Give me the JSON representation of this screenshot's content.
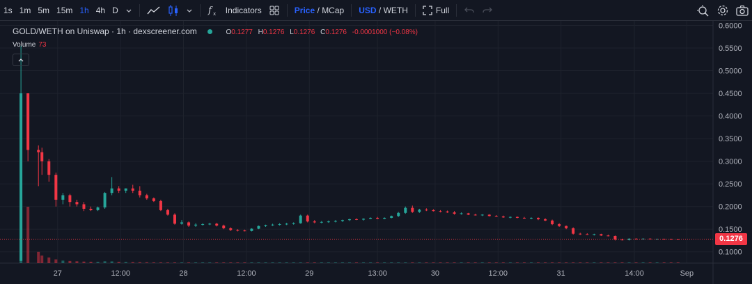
{
  "toolbar": {
    "intervals": [
      "1s",
      "1m",
      "5m",
      "15m",
      "1h",
      "4h",
      "D"
    ],
    "active_interval": "1h",
    "indicators_label": "Indicators",
    "price_label": "Price",
    "slash": "/",
    "mcap_label": "MCap",
    "usd_label": "USD",
    "weth_label": "WETH",
    "full_label": "Full",
    "icons": [
      "chevron-down-icon",
      "line-chart-icon",
      "candles-icon",
      "fx-icon",
      "grid-icon",
      "fullscreen-icon",
      "undo-icon",
      "redo-icon",
      "magic-icon",
      "gear-icon",
      "camera-icon"
    ]
  },
  "legend": {
    "title": "GOLD/WETH on Uniswap · 1h · dexscreener.com",
    "o_label": "O",
    "o_value": "0.1277",
    "h_label": "H",
    "h_value": "0.1276",
    "l_label": "L",
    "l_value": "0.1276",
    "c_label": "C",
    "c_value": "0.1276",
    "change": "-0.0001000 (−0.08%)",
    "volume_label": "Volume",
    "volume_value": "73"
  },
  "colors": {
    "up": "#26a69a",
    "down": "#f23645",
    "background": "#131722",
    "accent": "#2962ff"
  },
  "chart_data": {
    "type": "candlestick",
    "title": "GOLD/WETH on Uniswap · 1h · dexscreener.com",
    "current_price": 0.1276,
    "current_price_label": "0.1276",
    "y_ticks": [
      0.1,
      0.15,
      0.2,
      0.25,
      0.3,
      0.35,
      0.4,
      0.45,
      0.5,
      0.55,
      0.6
    ],
    "y_tick_labels": [
      "0.1000",
      "0.1500",
      "0.2000",
      "0.2500",
      "0.3000",
      "0.3500",
      "0.4000",
      "0.4500",
      "0.5000",
      "0.5500",
      "0.6000"
    ],
    "ylim": [
      0.075,
      0.61
    ],
    "x_tick_labels": [
      "27",
      "12:00",
      "28",
      "12:00",
      "29",
      "13:00",
      "30",
      "12:00",
      "31",
      "14:00",
      "Sep"
    ],
    "x_tick_hours": [
      9,
      21,
      33,
      45,
      57,
      70,
      81,
      93,
      105,
      119,
      129
    ],
    "xlim": [
      -2,
      134
    ],
    "candles": [
      {
        "t": 0,
        "o": 0.08,
        "h": 0.555,
        "l": 0.08,
        "c": 0.45
      },
      {
        "t": 1,
        "o": 0.45,
        "h": 0.45,
        "l": 0.3,
        "c": 0.325
      },
      {
        "t": 2,
        "o": 0.325,
        "h": 0.335,
        "l": 0.245,
        "c": 0.32
      },
      {
        "t": 3,
        "o": 0.32,
        "h": 0.33,
        "l": 0.27,
        "c": 0.3
      },
      {
        "t": 4,
        "o": 0.3,
        "h": 0.305,
        "l": 0.255,
        "c": 0.27
      },
      {
        "t": 5,
        "o": 0.27,
        "h": 0.275,
        "l": 0.2,
        "c": 0.215
      },
      {
        "t": 6,
        "o": 0.215,
        "h": 0.23,
        "l": 0.205,
        "c": 0.225
      },
      {
        "t": 7,
        "o": 0.225,
        "h": 0.228,
        "l": 0.2,
        "c": 0.21
      },
      {
        "t": 8,
        "o": 0.21,
        "h": 0.215,
        "l": 0.2,
        "c": 0.205
      },
      {
        "t": 9,
        "o": 0.205,
        "h": 0.21,
        "l": 0.19,
        "c": 0.195
      },
      {
        "t": 10,
        "o": 0.195,
        "h": 0.2,
        "l": 0.19,
        "c": 0.192
      },
      {
        "t": 11,
        "o": 0.192,
        "h": 0.2,
        "l": 0.19,
        "c": 0.198
      },
      {
        "t": 12,
        "o": 0.198,
        "h": 0.232,
        "l": 0.195,
        "c": 0.23
      },
      {
        "t": 13,
        "o": 0.23,
        "h": 0.265,
        "l": 0.225,
        "c": 0.24
      },
      {
        "t": 14,
        "o": 0.24,
        "h": 0.245,
        "l": 0.23,
        "c": 0.235
      },
      {
        "t": 15,
        "o": 0.235,
        "h": 0.24,
        "l": 0.23,
        "c": 0.24
      },
      {
        "t": 16,
        "o": 0.24,
        "h": 0.248,
        "l": 0.23,
        "c": 0.235
      },
      {
        "t": 17,
        "o": 0.235,
        "h": 0.245,
        "l": 0.22,
        "c": 0.225
      },
      {
        "t": 18,
        "o": 0.225,
        "h": 0.228,
        "l": 0.215,
        "c": 0.218
      },
      {
        "t": 19,
        "o": 0.218,
        "h": 0.22,
        "l": 0.21,
        "c": 0.212
      },
      {
        "t": 20,
        "o": 0.212,
        "h": 0.215,
        "l": 0.19,
        "c": 0.192
      },
      {
        "t": 21,
        "o": 0.192,
        "h": 0.195,
        "l": 0.18,
        "c": 0.182
      },
      {
        "t": 22,
        "o": 0.182,
        "h": 0.185,
        "l": 0.16,
        "c": 0.162
      },
      {
        "t": 23,
        "o": 0.162,
        "h": 0.17,
        "l": 0.16,
        "c": 0.165
      },
      {
        "t": 24,
        "o": 0.165,
        "h": 0.167,
        "l": 0.155,
        "c": 0.158
      },
      {
        "t": 25,
        "o": 0.158,
        "h": 0.163,
        "l": 0.155,
        "c": 0.16
      },
      {
        "t": 26,
        "o": 0.16,
        "h": 0.163,
        "l": 0.158,
        "c": 0.161
      },
      {
        "t": 27,
        "o": 0.161,
        "h": 0.164,
        "l": 0.159,
        "c": 0.162
      },
      {
        "t": 28,
        "o": 0.162,
        "h": 0.164,
        "l": 0.156,
        "c": 0.158
      },
      {
        "t": 29,
        "o": 0.158,
        "h": 0.16,
        "l": 0.15,
        "c": 0.152
      },
      {
        "t": 30,
        "o": 0.152,
        "h": 0.154,
        "l": 0.146,
        "c": 0.148
      },
      {
        "t": 31,
        "o": 0.148,
        "h": 0.15,
        "l": 0.145,
        "c": 0.147
      },
      {
        "t": 32,
        "o": 0.147,
        "h": 0.149,
        "l": 0.145,
        "c": 0.146
      },
      {
        "t": 33,
        "o": 0.146,
        "h": 0.152,
        "l": 0.145,
        "c": 0.151
      },
      {
        "t": 34,
        "o": 0.151,
        "h": 0.158,
        "l": 0.15,
        "c": 0.157
      },
      {
        "t": 35,
        "o": 0.157,
        "h": 0.16,
        "l": 0.155,
        "c": 0.159
      },
      {
        "t": 36,
        "o": 0.159,
        "h": 0.162,
        "l": 0.157,
        "c": 0.16
      },
      {
        "t": 37,
        "o": 0.16,
        "h": 0.163,
        "l": 0.158,
        "c": 0.161
      },
      {
        "t": 38,
        "o": 0.161,
        "h": 0.164,
        "l": 0.159,
        "c": 0.162
      },
      {
        "t": 39,
        "o": 0.162,
        "h": 0.165,
        "l": 0.16,
        "c": 0.163
      },
      {
        "t": 40,
        "o": 0.163,
        "h": 0.182,
        "l": 0.162,
        "c": 0.18
      },
      {
        "t": 41,
        "o": 0.18,
        "h": 0.182,
        "l": 0.165,
        "c": 0.167
      },
      {
        "t": 42,
        "o": 0.167,
        "h": 0.17,
        "l": 0.163,
        "c": 0.165
      },
      {
        "t": 43,
        "o": 0.165,
        "h": 0.168,
        "l": 0.163,
        "c": 0.166
      },
      {
        "t": 44,
        "o": 0.166,
        "h": 0.169,
        "l": 0.164,
        "c": 0.167
      },
      {
        "t": 45,
        "o": 0.167,
        "h": 0.17,
        "l": 0.165,
        "c": 0.168
      },
      {
        "t": 46,
        "o": 0.168,
        "h": 0.171,
        "l": 0.166,
        "c": 0.17
      },
      {
        "t": 47,
        "o": 0.17,
        "h": 0.173,
        "l": 0.168,
        "c": 0.172
      },
      {
        "t": 48,
        "o": 0.172,
        "h": 0.174,
        "l": 0.17,
        "c": 0.171
      },
      {
        "t": 49,
        "o": 0.171,
        "h": 0.174,
        "l": 0.169,
        "c": 0.173
      },
      {
        "t": 50,
        "o": 0.173,
        "h": 0.176,
        "l": 0.172,
        "c": 0.175
      },
      {
        "t": 51,
        "o": 0.175,
        "h": 0.177,
        "l": 0.172,
        "c": 0.173
      },
      {
        "t": 52,
        "o": 0.173,
        "h": 0.176,
        "l": 0.172,
        "c": 0.175
      },
      {
        "t": 53,
        "o": 0.175,
        "h": 0.18,
        "l": 0.174,
        "c": 0.179
      },
      {
        "t": 54,
        "o": 0.179,
        "h": 0.188,
        "l": 0.177,
        "c": 0.186
      },
      {
        "t": 55,
        "o": 0.186,
        "h": 0.2,
        "l": 0.184,
        "c": 0.197
      },
      {
        "t": 56,
        "o": 0.197,
        "h": 0.202,
        "l": 0.186,
        "c": 0.188
      },
      {
        "t": 57,
        "o": 0.188,
        "h": 0.195,
        "l": 0.186,
        "c": 0.193
      },
      {
        "t": 58,
        "o": 0.193,
        "h": 0.196,
        "l": 0.19,
        "c": 0.192
      },
      {
        "t": 59,
        "o": 0.192,
        "h": 0.194,
        "l": 0.189,
        "c": 0.19
      },
      {
        "t": 60,
        "o": 0.19,
        "h": 0.192,
        "l": 0.187,
        "c": 0.189
      },
      {
        "t": 61,
        "o": 0.189,
        "h": 0.191,
        "l": 0.186,
        "c": 0.187
      },
      {
        "t": 62,
        "o": 0.187,
        "h": 0.19,
        "l": 0.182,
        "c": 0.184
      },
      {
        "t": 63,
        "o": 0.184,
        "h": 0.187,
        "l": 0.182,
        "c": 0.185
      },
      {
        "t": 64,
        "o": 0.185,
        "h": 0.186,
        "l": 0.181,
        "c": 0.182
      },
      {
        "t": 65,
        "o": 0.182,
        "h": 0.184,
        "l": 0.18,
        "c": 0.181
      },
      {
        "t": 66,
        "o": 0.181,
        "h": 0.183,
        "l": 0.179,
        "c": 0.182
      },
      {
        "t": 67,
        "o": 0.182,
        "h": 0.183,
        "l": 0.178,
        "c": 0.179
      },
      {
        "t": 68,
        "o": 0.179,
        "h": 0.181,
        "l": 0.177,
        "c": 0.178
      },
      {
        "t": 69,
        "o": 0.178,
        "h": 0.18,
        "l": 0.175,
        "c": 0.176
      },
      {
        "t": 70,
        "o": 0.176,
        "h": 0.178,
        "l": 0.174,
        "c": 0.177
      },
      {
        "t": 71,
        "o": 0.177,
        "h": 0.178,
        "l": 0.174,
        "c": 0.175
      },
      {
        "t": 72,
        "o": 0.175,
        "h": 0.177,
        "l": 0.173,
        "c": 0.174
      },
      {
        "t": 73,
        "o": 0.174,
        "h": 0.176,
        "l": 0.172,
        "c": 0.175
      },
      {
        "t": 74,
        "o": 0.175,
        "h": 0.176,
        "l": 0.17,
        "c": 0.172
      },
      {
        "t": 75,
        "o": 0.172,
        "h": 0.174,
        "l": 0.168,
        "c": 0.169
      },
      {
        "t": 76,
        "o": 0.169,
        "h": 0.171,
        "l": 0.159,
        "c": 0.161
      },
      {
        "t": 77,
        "o": 0.161,
        "h": 0.163,
        "l": 0.155,
        "c": 0.157
      },
      {
        "t": 78,
        "o": 0.157,
        "h": 0.158,
        "l": 0.15,
        "c": 0.152
      },
      {
        "t": 79,
        "o": 0.152,
        "h": 0.154,
        "l": 0.138,
        "c": 0.14
      },
      {
        "t": 80,
        "o": 0.14,
        "h": 0.142,
        "l": 0.137,
        "c": 0.139
      },
      {
        "t": 81,
        "o": 0.139,
        "h": 0.141,
        "l": 0.137,
        "c": 0.138
      },
      {
        "t": 82,
        "o": 0.138,
        "h": 0.14,
        "l": 0.136,
        "c": 0.139
      },
      {
        "t": 83,
        "o": 0.139,
        "h": 0.14,
        "l": 0.135,
        "c": 0.136
      },
      {
        "t": 84,
        "o": 0.136,
        "h": 0.138,
        "l": 0.134,
        "c": 0.135
      },
      {
        "t": 85,
        "o": 0.135,
        "h": 0.136,
        "l": 0.125,
        "c": 0.127
      },
      {
        "t": 86,
        "o": 0.127,
        "h": 0.129,
        "l": 0.125,
        "c": 0.126
      },
      {
        "t": 87,
        "o": 0.126,
        "h": 0.13,
        "l": 0.125,
        "c": 0.129
      },
      {
        "t": 88,
        "o": 0.129,
        "h": 0.13,
        "l": 0.127,
        "c": 0.128
      },
      {
        "t": 89,
        "o": 0.128,
        "h": 0.13,
        "l": 0.127,
        "c": 0.129
      },
      {
        "t": 90,
        "o": 0.129,
        "h": 0.13,
        "l": 0.127,
        "c": 0.128
      },
      {
        "t": 91,
        "o": 0.128,
        "h": 0.129,
        "l": 0.127,
        "c": 0.1285
      },
      {
        "t": 92,
        "o": 0.1285,
        "h": 0.129,
        "l": 0.127,
        "c": 0.128
      },
      {
        "t": 93,
        "o": 0.128,
        "h": 0.129,
        "l": 0.127,
        "c": 0.1277
      },
      {
        "t": 94,
        "o": 0.1277,
        "h": 0.1278,
        "l": 0.1276,
        "c": 0.1276
      }
    ],
    "x_positions": [
      3,
      5,
      8,
      9,
      11,
      13,
      15,
      17,
      19,
      21,
      23,
      25,
      27,
      29,
      31,
      33,
      35,
      37,
      39,
      41,
      43,
      45,
      47,
      49,
      51,
      53,
      55,
      57,
      59,
      61,
      63,
      65,
      67,
      69,
      71,
      73,
      75,
      77,
      79,
      81,
      83,
      85,
      87,
      89,
      91,
      93,
      95,
      97,
      99,
      101,
      103,
      105,
      107,
      109,
      111,
      113,
      115,
      117,
      119,
      121,
      123,
      125,
      127,
      129,
      131,
      133,
      135,
      137,
      139,
      141,
      143,
      145,
      147,
      149,
      151,
      153,
      155,
      157,
      159,
      161,
      163,
      165,
      167,
      169,
      171,
      173,
      175,
      177,
      179,
      181,
      183,
      185,
      187,
      189,
      191
    ],
    "volume_ylim": [
      0,
      1000
    ],
    "volumes": [
      1000,
      900,
      180,
      120,
      90,
      60,
      40,
      35,
      30,
      25,
      22,
      20,
      30,
      28,
      20,
      18,
      16,
      15,
      14,
      12,
      12,
      11,
      10,
      10,
      9,
      9,
      8,
      8,
      8,
      8,
      7,
      7,
      7,
      7,
      7,
      7,
      7,
      7,
      7,
      7,
      7,
      7,
      6,
      6,
      6,
      6,
      6,
      6,
      6,
      6,
      6,
      6,
      6,
      6,
      6,
      6,
      6,
      6,
      6,
      6,
      6,
      6,
      6,
      6,
      6,
      6,
      6,
      6,
      6,
      6,
      6,
      6,
      6,
      6,
      6,
      6,
      6,
      6,
      6,
      6,
      6,
      6,
      6,
      6,
      6,
      6,
      6,
      6,
      6,
      6,
      6,
      6,
      6,
      6,
      6
    ]
  }
}
